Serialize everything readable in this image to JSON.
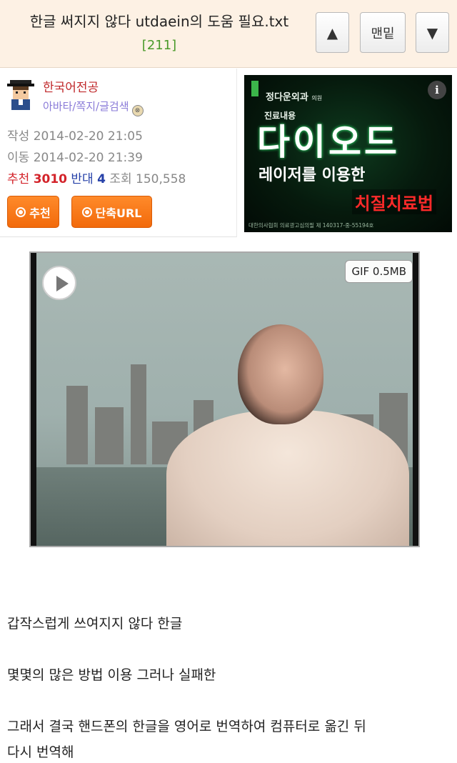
{
  "header": {
    "title": "한글 써지지 않다 utdaein의 도움 필요.txt",
    "count": "[211]",
    "up_label": "▲",
    "bottom_label": "맨밑",
    "down_label": "▼"
  },
  "post": {
    "author": "한국어전공",
    "author_links": "아바타/쪽지/글검색",
    "created_label": "작성",
    "created": "2014-02-20 21:05",
    "moved_label": "이동",
    "moved": "2014-02-20 21:39",
    "recommend_label": "추천",
    "recommend_count": "3010",
    "oppose_label": "반대",
    "oppose_count": "4",
    "views_label": "조회",
    "views": "150,558",
    "recommend_button": "추천",
    "shorturl_button": "단축URL"
  },
  "ad": {
    "clinic": "정다운외과",
    "clinic_suffix": "의원",
    "subtitle": "진료내용",
    "headline": "다이오드",
    "middle": "레이저를 이용한",
    "emphasis": "치질치료법",
    "fine_print": "대한의사협회 의료광고심의필 제 140317-중-55194호",
    "info_icon": "info-icon"
  },
  "gif": {
    "badge": "GIF 0.5MB",
    "play_icon": "play-icon"
  },
  "body": {
    "line1": "갑작스럽게 쓰여지지 않다 한글",
    "line2": "몇몇의 많은 방법 이용 그러나 실패한",
    "line3": "그래서 결국 핸드폰의 한글을 영어로 번역하여 컴퓨터로 옮긴 뒤",
    "line4": "다시 번역해"
  },
  "colors": {
    "header_bg": "#fdf1e4",
    "count_green": "#4a9a2a",
    "author_red": "#c0292b",
    "link_purple": "#8a7bd8",
    "button_orange": "#f26a0b",
    "oppose_blue": "#2540a8"
  }
}
